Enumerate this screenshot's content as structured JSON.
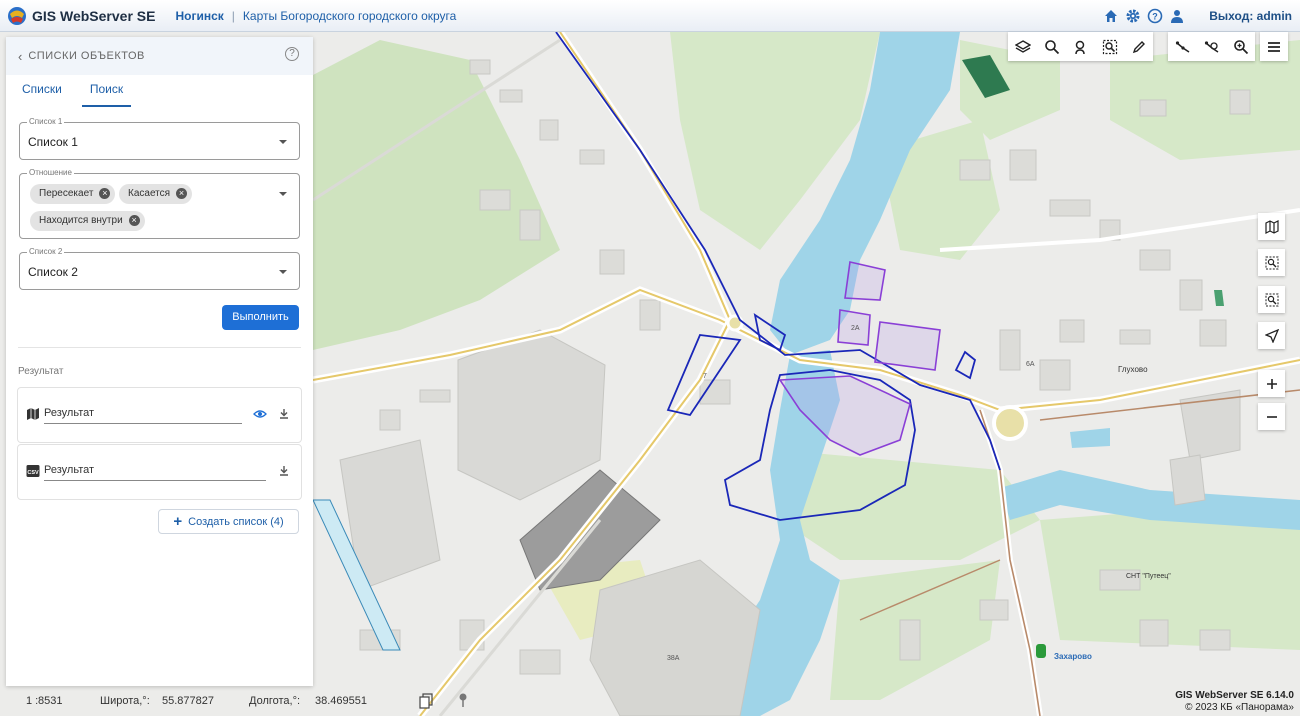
{
  "header": {
    "app_title": "GIS WebServer SE",
    "project": "Ногинск",
    "separator": "|",
    "map_title": "Карты Богородского городского округа",
    "logout": "Выход: admin",
    "icons": [
      "home-icon",
      "gear-icon",
      "help-icon",
      "user-icon"
    ]
  },
  "panel": {
    "title": "СПИСКИ ОБЪЕКТОВ",
    "help": "?",
    "tabs": [
      {
        "label": "Списки",
        "active": false
      },
      {
        "label": "Поиск",
        "active": true
      }
    ],
    "list1": {
      "label": "Список 1",
      "value": "Список 1"
    },
    "relation": {
      "label": "Отношение",
      "chips": [
        "Пересекает",
        "Касается",
        "Находится внутри"
      ]
    },
    "list2": {
      "label": "Список 2",
      "value": "Список 2"
    },
    "run_button": "Выполнить",
    "result_title": "Результат",
    "results": [
      {
        "icon": "map-icon",
        "name": "Результат",
        "actions": [
          "eye-icon",
          "download-icon"
        ]
      },
      {
        "icon": "csv-icon",
        "icon_text": "CSV",
        "name": "Результат",
        "actions": [
          "download-icon"
        ]
      }
    ],
    "create_button": "Создать список (4)"
  },
  "status": {
    "scale_label": "1 :",
    "scale_value": "8531",
    "lat_label": "Широта,°:",
    "lat_value": "55.877827",
    "lon_label": "Долгота,°:",
    "lon_value": "38.469551"
  },
  "footer": {
    "version": "GIS WebServer SE 6.14.0",
    "copyright": "© 2023 КБ «Панорама»"
  },
  "map_labels": {
    "glukhovo": "Глухово",
    "zakharovo": "Захарово",
    "snt": "СНТ \"Путеец\"",
    "label_6a": "6А",
    "label_2a": "2А",
    "label_38a": "38А",
    "label_7": "7"
  },
  "toolbar_icons": [
    "layers-icon",
    "search-icon",
    "search-object-icon",
    "area-search-icon",
    "edit-icon",
    "measure-icon",
    "measure-area-icon",
    "zoom-icon",
    "menu-icon"
  ],
  "side_icons": [
    "map-icon",
    "zoom-region-icon",
    "zoom-rect-icon",
    "locate-icon",
    "zoom-in-icon",
    "zoom-out-icon"
  ],
  "colors": {
    "accent": "#1e6fd6",
    "water": "#9fd4e8",
    "green": "#cfe3bf",
    "selection_blue": "#1a27b8",
    "selection_purple": "#8a3fd6"
  }
}
